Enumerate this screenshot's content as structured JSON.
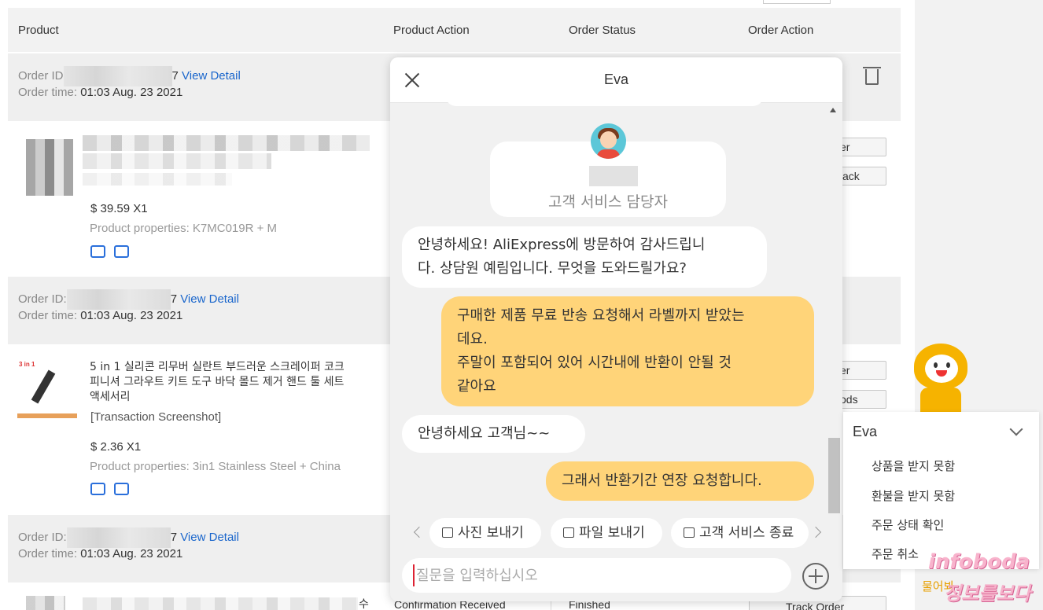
{
  "table_header": {
    "product": "Product",
    "product_action": "Product Action",
    "order_status": "Order Status",
    "order_action": "Order Action"
  },
  "orders": [
    {
      "order_id_label": "Order ID",
      "order_id_suffix": "7",
      "view_detail": "View Detail",
      "order_time_label": "Order time:",
      "order_time": "01:03 Aug. 23 2021",
      "price": "$ 39.59 X1",
      "properties": "Product properties: K7MC019R + M",
      "btn1": "er",
      "btn2": "ack"
    },
    {
      "order_id_label": "Order ID:",
      "order_id_suffix": "7",
      "view_detail": "View Detail",
      "order_time_label": "Order time:",
      "order_time": "01:03 Aug. 23 2021",
      "thumb_label": "3 in 1",
      "title_line1": "5 in 1 실리콘 리무버 실란트 부드러운 스크레이퍼 코크",
      "title_line2": "피니셔 그라우트 키트 도구 바닥 몰드 제거 핸드 툴 세트",
      "title_line3": "액세서리",
      "screenshot": "[Transaction Screenshot]",
      "price": "$ 2.36 X1",
      "properties": "Product properties: 3in1 Stainless Steel + China",
      "btn1": "er",
      "btn2": "ods"
    },
    {
      "order_id_label": "Order ID:",
      "order_id_suffix": "7",
      "view_detail": "View Detail",
      "order_time_label": "Order time:",
      "order_time": "01:03 Aug. 23 2021",
      "title_fragment": "수",
      "status_confirm": "Confirmation Received",
      "status_finished": "Finished",
      "track_order": "Track Order"
    }
  ],
  "chat": {
    "title": "Eva",
    "agent_role": "고객 서비스 담당자",
    "messages": [
      {
        "from": "agent",
        "lines": [
          "안녕하세요! AliExpress에 방문하여 감사드립니",
          "다. 상담원 예림입니다. 무엇을 도와드릴가요?"
        ]
      },
      {
        "from": "user",
        "lines": [
          "구매한 제품 무료 반송 요청해서 라벨까지 받았는",
          "데요.",
          "주말이 포함되어 있어 시간내에 반환이 안될 것",
          "같아요"
        ]
      },
      {
        "from": "agent",
        "lines": [
          "안녕하세요 고객님~~"
        ]
      },
      {
        "from": "user",
        "lines": [
          "그래서 반환기간 연장 요청합니다."
        ]
      }
    ],
    "quick_actions": [
      "사진 보내기",
      "파일 보내기",
      "고객 서비스 종료"
    ],
    "input_placeholder": "질문을 입력하십시오"
  },
  "assistant_widget": {
    "title": "Eva",
    "options": [
      "상품을 받지 못함",
      "환불을 받지 못함",
      "주문 상태 확인",
      "주문 취소"
    ],
    "ask_label": "물어봐"
  },
  "watermark": {
    "line1": "infoboda",
    "line2": "정보를보다"
  }
}
